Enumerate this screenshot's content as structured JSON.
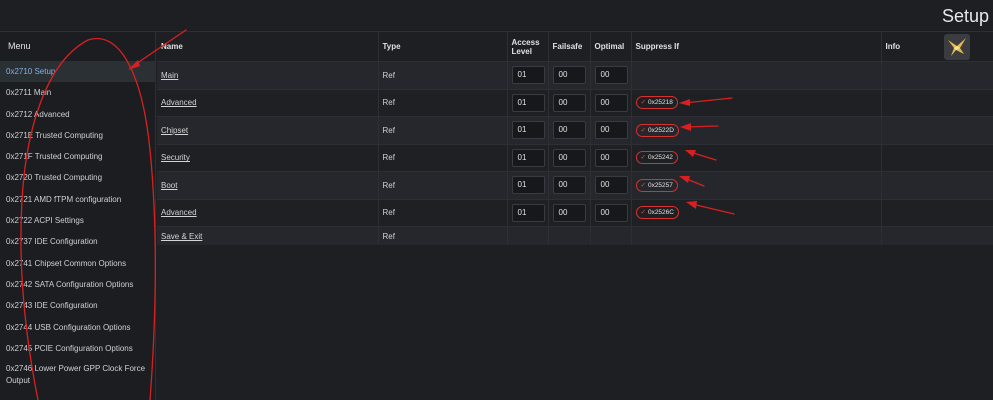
{
  "header": {
    "title": "Setup"
  },
  "sidebar": {
    "title": "Menu",
    "items": [
      {
        "label": "0x2710 Setup"
      },
      {
        "label": "0x2711 Main"
      },
      {
        "label": "0x2712 Advanced"
      },
      {
        "label": "0x271E Trusted Computing"
      },
      {
        "label": "0x271F Trusted Computing"
      },
      {
        "label": "0x2720 Trusted Computing"
      },
      {
        "label": "0x2721 AMD fTPM configuration"
      },
      {
        "label": "0x2722 ACPI Settings"
      },
      {
        "label": "0x2737 IDE Configuration"
      },
      {
        "label": "0x2741 Chipset Common Options"
      },
      {
        "label": "0x2742 SATA Configuration Options"
      },
      {
        "label": "0x2743 IDE Configuration"
      },
      {
        "label": "0x2744 USB Configuration Options"
      },
      {
        "label": "0x2745 PCIE Configuration Options"
      },
      {
        "label": "0x2746 Lower Power GPP Clock Force Output"
      }
    ]
  },
  "table": {
    "headers": {
      "name": "Name",
      "type": "Type",
      "access": "Access Level",
      "failsafe": "Failsafe",
      "optimal": "Optimal",
      "suppress": "Suppress If",
      "info": "Info"
    },
    "rows": [
      {
        "name": "Main",
        "type": "Ref",
        "access": "01",
        "failsafe": "00",
        "optimal": "00",
        "suppress": ""
      },
      {
        "name": "Advanced",
        "type": "Ref",
        "access": "01",
        "failsafe": "00",
        "optimal": "00",
        "suppress": "0x25218"
      },
      {
        "name": "Chipset",
        "type": "Ref",
        "access": "01",
        "failsafe": "00",
        "optimal": "00",
        "suppress": "0x2522D"
      },
      {
        "name": "Security",
        "type": "Ref",
        "access": "01",
        "failsafe": "00",
        "optimal": "00",
        "suppress": "0x25242"
      },
      {
        "name": "Boot",
        "type": "Ref",
        "access": "01",
        "failsafe": "00",
        "optimal": "00",
        "suppress": "0x25257"
      },
      {
        "name": "Advanced",
        "type": "Ref",
        "access": "01",
        "failsafe": "00",
        "optimal": "00",
        "suppress": "0x2526C"
      },
      {
        "name": "Save & Exit",
        "type": "Ref"
      }
    ]
  },
  "colors": {
    "accent": "#7fb2e6",
    "annotation": "#d92020",
    "chip_border": "#d93030"
  },
  "icons": {
    "logo": "bird-logo-icon",
    "check": "check-icon"
  }
}
